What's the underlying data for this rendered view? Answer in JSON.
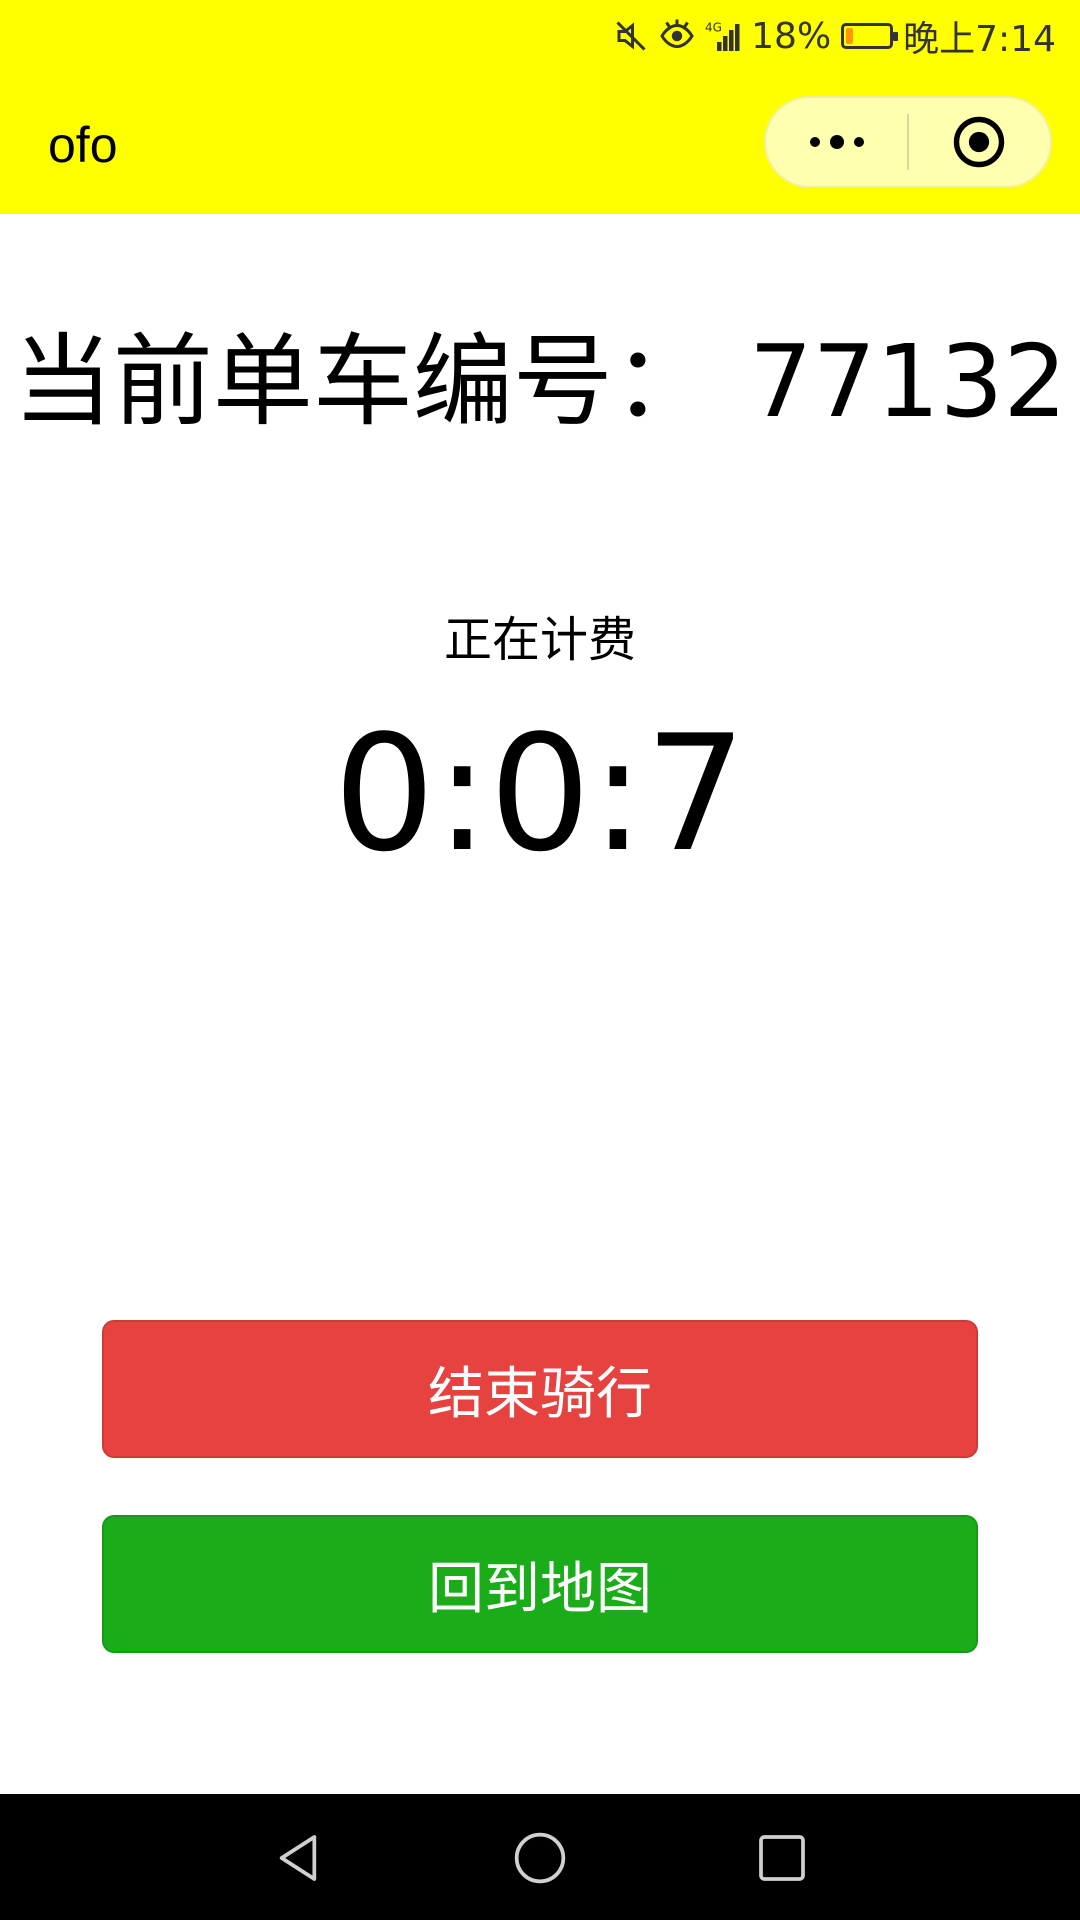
{
  "status_bar": {
    "battery_percent": "18%",
    "battery_level": 0.18,
    "time": "晚上7:14",
    "network": "4G",
    "icons": [
      "mute-icon",
      "eye-comfort-icon",
      "signal-icon",
      "battery-icon"
    ]
  },
  "nav": {
    "title": "ofo",
    "menu_icon": "more-dots-icon",
    "close_icon": "target-icon"
  },
  "main": {
    "bike_number_label": "当前单车编号：",
    "bike_number": "77132",
    "billing_status": "正在计费",
    "timer": "0:0:7"
  },
  "buttons": {
    "end_ride": "结束骑行",
    "back_to_map": "回到地图"
  },
  "colors": {
    "header_bg": "#ffff00",
    "end_button": "#e64340",
    "map_button": "#1aad19",
    "nav_bg": "#000000"
  },
  "system_nav": {
    "icons": [
      "back-icon",
      "home-icon",
      "recents-icon"
    ]
  }
}
